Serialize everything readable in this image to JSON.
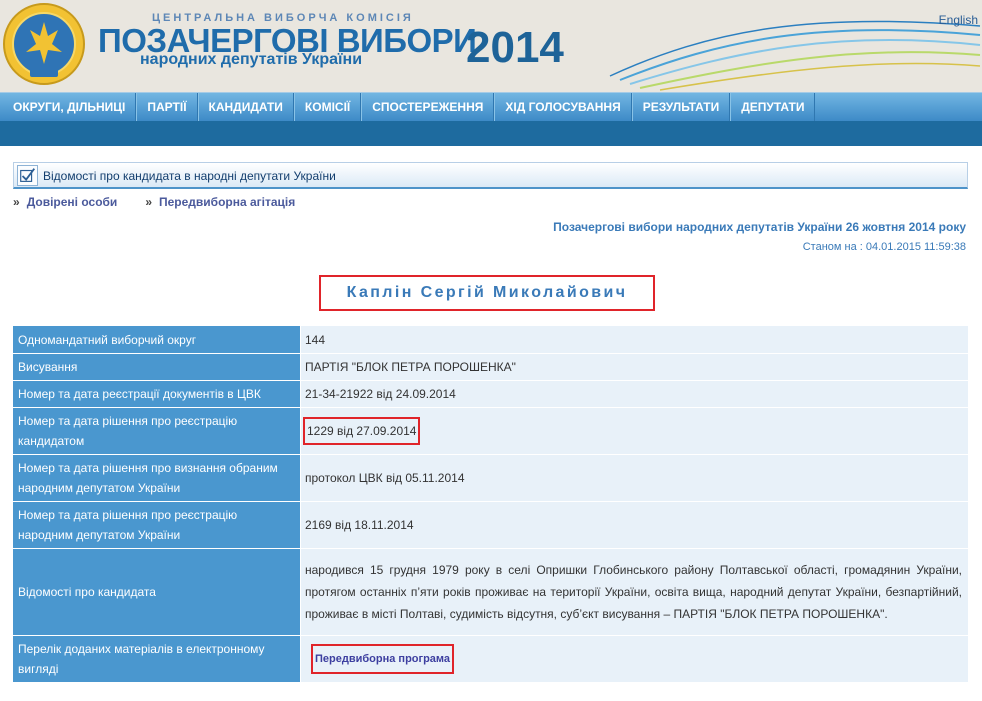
{
  "header": {
    "commission": "ЦЕНТРАЛЬНА ВИБОРЧА КОМІСІЯ",
    "title_line1": "ПОЗАЧЕРГОВІ ВИБОРИ",
    "title_line2": "народних депутатів України",
    "year": "2014",
    "lang_link": "English"
  },
  "nav": {
    "items": [
      "ОКРУГИ, ДІЛЬНИЦІ",
      "ПАРТІЇ",
      "КАНДИДАТИ",
      "КОМІСІЇ",
      "СПОСТЕРЕЖЕННЯ",
      "ХІД ГОЛОСУВАННЯ",
      "РЕЗУЛЬТАТИ",
      "ДЕПУТАТИ"
    ]
  },
  "section": {
    "title": "Відомості про кандидата в народні депутати України"
  },
  "sublinks": [
    {
      "arrow": "»",
      "label": "Довірені особи"
    },
    {
      "arrow": "»",
      "label": "Передвиборна агітація"
    }
  ],
  "election": {
    "name": "Позачергові вибори народних депутатів України 26 жовтня 2014 року",
    "as_of": "Станом на : 04.01.2015 11:59:38"
  },
  "candidate": {
    "name": "Каплін Сергій Миколайович"
  },
  "table": {
    "rows": [
      {
        "label": "Одномандатний виборчий округ",
        "value": "144"
      },
      {
        "label": "Висування",
        "value": "ПАРТІЯ \"БЛОК ПЕТРА ПОРОШЕНКА\""
      },
      {
        "label": "Номер та дата реєстрації документів в ЦВК",
        "value": "21-34-21922 від 24.09.2014"
      },
      {
        "label": "Номер та дата рішення про реєстрацію кандидатом",
        "value": "1229 від 27.09.2014"
      },
      {
        "label": "Номер та дата рішення про визнання обраним народним депутатом України",
        "value": "протокол ЦВК від 05.11.2014"
      },
      {
        "label": "Номер та дата рішення про реєстрацію народним депутатом України",
        "value": "2169 від 18.11.2014"
      },
      {
        "label": "Відомості про кандидата",
        "value": "народився 15 грудня 1979 року в селі Опришки Глобинського району Полтавської області, громадянин України, протягом останніх п’яти років проживає на території України, освіта вища, народний депутат України, безпартійний, проживає в місті Полтаві, судимість відсутня, суб’єкт висування – ПАРТІЯ \"БЛОК ПЕТРА ПОРОШЕНКА\"."
      },
      {
        "label": "Перелік доданих матеріалів в електронному вигляді",
        "value": "Передвиборна програма"
      }
    ]
  },
  "colors": {
    "nav_top": "#72b6e2",
    "nav_bottom": "#3d8ac7",
    "nav_bar2": "#1e6b9f",
    "label_cell": "#4a97cf",
    "value_cell": "#e8f1f9",
    "highlight_border": "#e0242a",
    "accent_text": "#3a7ab8"
  }
}
